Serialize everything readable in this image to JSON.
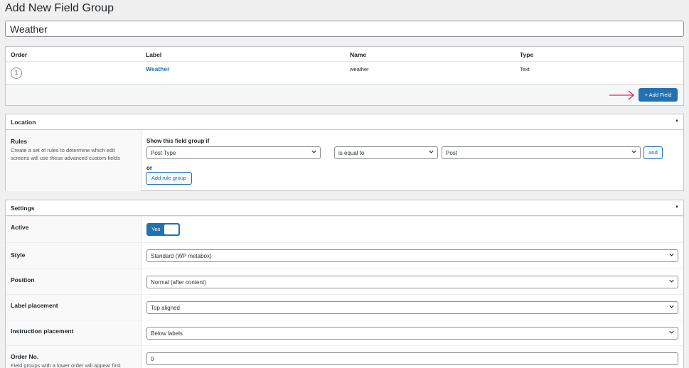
{
  "page": {
    "title": "Add New Field Group",
    "title_input_value": "Weather"
  },
  "fields": {
    "headers": {
      "order": "Order",
      "label": "Label",
      "name": "Name",
      "type": "Type"
    },
    "rows": [
      {
        "order": "1",
        "label": "Weather",
        "name": "weather",
        "type": "Text"
      }
    ],
    "add_field_label": "+ Add Field",
    "arrow_color": "#e0245e"
  },
  "location": {
    "title": "Location",
    "rules_label": "Rules",
    "rules_desc": "Create a set of rules to determine which edit screens will use these advanced custom fields",
    "show_if": "Show this field group if",
    "param": "Post Type",
    "operator": "is equal to",
    "value": "Post",
    "and_label": "and",
    "or_label": "or",
    "add_rule_group_label": "Add rule group"
  },
  "settings": {
    "title": "Settings",
    "active_label": "Active",
    "active_value": "Yes",
    "style_label": "Style",
    "style_value": "Standard (WP metabox)",
    "position_label": "Position",
    "position_value": "Normal (after content)",
    "label_placement_label": "Label placement",
    "label_placement_value": "Top aligned",
    "instruction_placement_label": "Instruction placement",
    "instruction_placement_value": "Below labels",
    "order_no_label": "Order No.",
    "order_no_desc": "Field groups with a lower order will appear first",
    "order_no_value": "0"
  },
  "colors": {
    "accent": "#2271b1",
    "background": "#f0f0f1"
  }
}
